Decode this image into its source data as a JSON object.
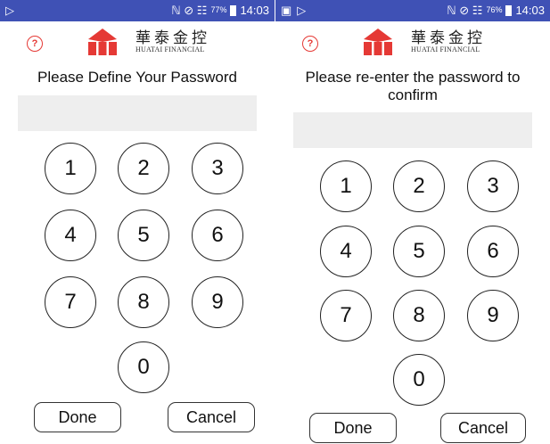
{
  "screens": [
    {
      "status": {
        "signal_glyphs": "ℕ ⊘ ☷",
        "battery": "77%",
        "time": "14:03"
      },
      "brand": {
        "cn": "華泰金控",
        "en": "HUATAI FINANCIAL",
        "help": "?"
      },
      "title": "Please Define Your Password",
      "keys": [
        "1",
        "2",
        "3",
        "4",
        "5",
        "6",
        "7",
        "8",
        "9",
        "0"
      ],
      "done": "Done",
      "cancel": "Cancel"
    },
    {
      "status": {
        "signal_glyphs": "ℕ ⊘ ☷",
        "battery": "76%",
        "time": "14:03"
      },
      "brand": {
        "cn": "華泰金控",
        "en": "HUATAI FINANCIAL",
        "help": "?"
      },
      "title": "Please re-enter the password to confirm",
      "keys": [
        "1",
        "2",
        "3",
        "4",
        "5",
        "6",
        "7",
        "8",
        "9",
        "0"
      ],
      "done": "Done",
      "cancel": "Cancel"
    }
  ],
  "colors": {
    "statusbar": "#3f51b5",
    "logo_red": "#e53935",
    "input_bg": "#eeeeee"
  }
}
